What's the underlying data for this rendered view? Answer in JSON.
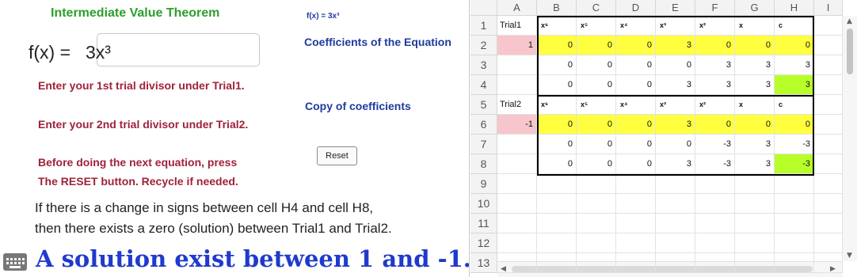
{
  "left_panel": {
    "title": "Intermediate Value Theorem",
    "equation_small": "f(x) = 3x³",
    "equation_label": "f(x) =",
    "equation_value": "3x³",
    "coefficients_label": "Coefficients of the Equation",
    "instruction_trial1": "Enter your 1st trial divisor under Trial1.",
    "copy_label": "Copy of coefficients",
    "instruction_trial2": "Enter your 2nd trial divisor under Trial2.",
    "reset_button": "Reset",
    "reset_note_line1": "Before doing the next equation, press",
    "reset_note_line2": "The RESET button. Recycle if needed.",
    "sign_change_line1": "If there is a change in signs between cell H4 and cell H8,",
    "sign_change_line2": "then there exists a zero (solution) between Trial1 and Trial2.",
    "solution_text": "A solution exist between 1 and -1."
  },
  "spreadsheet": {
    "columns": [
      "A",
      "B",
      "C",
      "D",
      "E",
      "F",
      "G",
      "H",
      "I"
    ],
    "rows": [
      "1",
      "2",
      "3",
      "4",
      "5",
      "6",
      "7",
      "8",
      "9",
      "10",
      "11",
      "12",
      "13"
    ],
    "cells": {
      "A1": "Trial1",
      "B1": "x⁶",
      "C1": "x⁵",
      "D1": "x⁴",
      "E1": "x³",
      "F1": "x²",
      "G1": "x",
      "H1": "c",
      "A2": "1",
      "B2": "0",
      "C2": "0",
      "D2": "0",
      "E2": "3",
      "F2": "0",
      "G2": "0",
      "H2": "0",
      "B3": "0",
      "C3": "0",
      "D3": "0",
      "E3": "0",
      "F3": "3",
      "G3": "3",
      "H3": "3",
      "B4": "0",
      "C4": "0",
      "D4": "0",
      "E4": "3",
      "F4": "3",
      "G4": "3",
      "H4": "3",
      "A5": "Trial2",
      "B5": "x⁶",
      "C5": "x⁵",
      "D5": "x⁴",
      "E5": "x³",
      "F5": "x²",
      "G5": "x",
      "H5": "c",
      "A6": "-1",
      "B6": "0",
      "C6": "0",
      "D6": "0",
      "E6": "3",
      "F6": "0",
      "G6": "0",
      "H6": "0",
      "B7": "0",
      "C7": "0",
      "D7": "0",
      "E7": "0",
      "F7": "-3",
      "G7": "3",
      "H7": "-3",
      "B8": "0",
      "C8": "0",
      "D8": "0",
      "E8": "3",
      "F8": "-3",
      "G8": "3",
      "H8": "-3"
    },
    "colors": {
      "trial_input": "#f7c6cc",
      "coefficients": "#ffff40",
      "result": "#b8ff2a",
      "header_bg": "#f3f3f3"
    }
  }
}
